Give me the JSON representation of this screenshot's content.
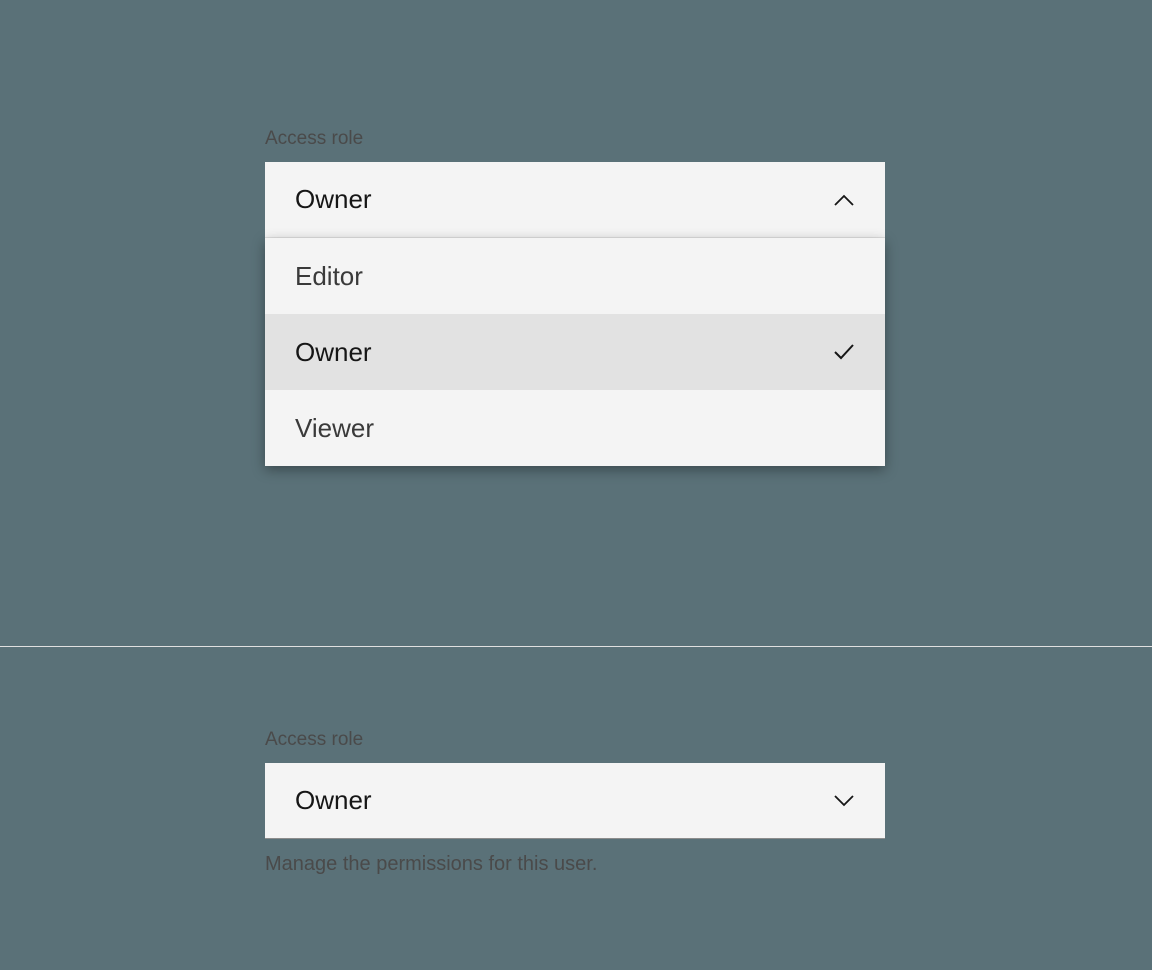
{
  "open_dropdown": {
    "label": "Access role",
    "selected": "Owner",
    "options": [
      {
        "label": "Editor",
        "selected": false
      },
      {
        "label": "Owner",
        "selected": true
      },
      {
        "label": "Viewer",
        "selected": false
      }
    ]
  },
  "closed_dropdown": {
    "label": "Access role",
    "selected": "Owner",
    "helper": "Manage the permissions for this user."
  }
}
